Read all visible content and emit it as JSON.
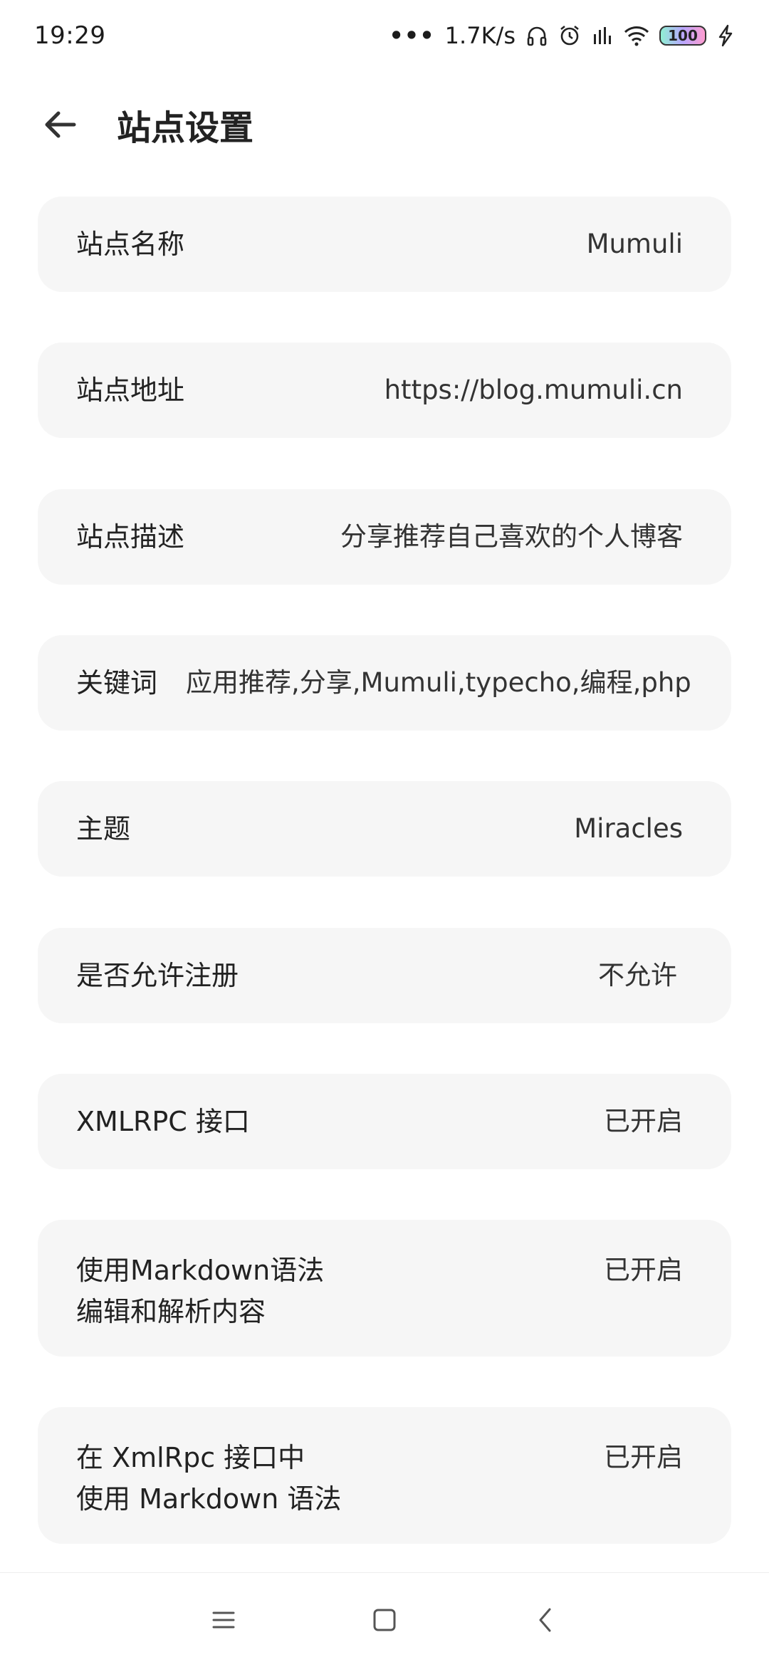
{
  "status_bar": {
    "time": "19:29",
    "network_speed": "1.7K/s",
    "battery_level": "100",
    "icons": [
      "more-dots-icon",
      "headphones-icon",
      "alarm-icon",
      "signal-icon",
      "wifi-icon",
      "battery-icon",
      "charging-icon"
    ]
  },
  "header": {
    "title": "站点设置",
    "back_icon": "arrow-left-icon"
  },
  "settings": [
    {
      "label": "站点名称",
      "value": "Mumuli"
    },
    {
      "label": "站点地址",
      "value": "https://blog.mumuli.cn"
    },
    {
      "label": "站点描述",
      "value": "分享推荐自己喜欢的个人博客"
    },
    {
      "label": "关键词",
      "value": "应用推荐,分享,Mumuli,typecho,编程,php"
    },
    {
      "label": "主题",
      "value": "Miracles"
    },
    {
      "label": "是否允许注册",
      "value": "不允许"
    },
    {
      "label": "XMLRPC 接口",
      "value": "已开启"
    },
    {
      "label": "使用Markdown语法\n编辑和解析内容",
      "value": "已开启"
    },
    {
      "label": "在 XmlRpc 接口中\n使用 Markdown 语法",
      "value": "已开启"
    }
  ],
  "nav_bar": {
    "icons": [
      "menu-icon",
      "home-square-icon",
      "back-chevron-icon"
    ]
  },
  "colors": {
    "background": "#ffffff",
    "card": "#f6f6f6",
    "text": "#222222"
  }
}
